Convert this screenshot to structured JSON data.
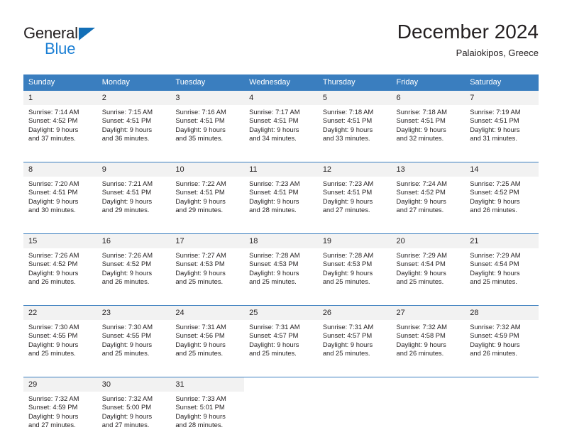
{
  "brand": {
    "name_primary": "General",
    "name_secondary": "Blue",
    "triangle_color": "#136fb7",
    "secondary_color": "#1b7fd4"
  },
  "header": {
    "title": "December 2024",
    "subtitle": "Palaiokipos, Greece",
    "header_bg": "#3a7ebf",
    "daynum_bg": "#f2f2f2"
  },
  "weekday_headers": [
    "Sunday",
    "Monday",
    "Tuesday",
    "Wednesday",
    "Thursday",
    "Friday",
    "Saturday"
  ],
  "weeks": [
    {
      "days": [
        {
          "num": "1",
          "sunrise": "Sunrise: 7:14 AM",
          "sunset": "Sunset: 4:52 PM",
          "daylight1": "Daylight: 9 hours",
          "daylight2": "and 37 minutes."
        },
        {
          "num": "2",
          "sunrise": "Sunrise: 7:15 AM",
          "sunset": "Sunset: 4:51 PM",
          "daylight1": "Daylight: 9 hours",
          "daylight2": "and 36 minutes."
        },
        {
          "num": "3",
          "sunrise": "Sunrise: 7:16 AM",
          "sunset": "Sunset: 4:51 PM",
          "daylight1": "Daylight: 9 hours",
          "daylight2": "and 35 minutes."
        },
        {
          "num": "4",
          "sunrise": "Sunrise: 7:17 AM",
          "sunset": "Sunset: 4:51 PM",
          "daylight1": "Daylight: 9 hours",
          "daylight2": "and 34 minutes."
        },
        {
          "num": "5",
          "sunrise": "Sunrise: 7:18 AM",
          "sunset": "Sunset: 4:51 PM",
          "daylight1": "Daylight: 9 hours",
          "daylight2": "and 33 minutes."
        },
        {
          "num": "6",
          "sunrise": "Sunrise: 7:18 AM",
          "sunset": "Sunset: 4:51 PM",
          "daylight1": "Daylight: 9 hours",
          "daylight2": "and 32 minutes."
        },
        {
          "num": "7",
          "sunrise": "Sunrise: 7:19 AM",
          "sunset": "Sunset: 4:51 PM",
          "daylight1": "Daylight: 9 hours",
          "daylight2": "and 31 minutes."
        }
      ]
    },
    {
      "days": [
        {
          "num": "8",
          "sunrise": "Sunrise: 7:20 AM",
          "sunset": "Sunset: 4:51 PM",
          "daylight1": "Daylight: 9 hours",
          "daylight2": "and 30 minutes."
        },
        {
          "num": "9",
          "sunrise": "Sunrise: 7:21 AM",
          "sunset": "Sunset: 4:51 PM",
          "daylight1": "Daylight: 9 hours",
          "daylight2": "and 29 minutes."
        },
        {
          "num": "10",
          "sunrise": "Sunrise: 7:22 AM",
          "sunset": "Sunset: 4:51 PM",
          "daylight1": "Daylight: 9 hours",
          "daylight2": "and 29 minutes."
        },
        {
          "num": "11",
          "sunrise": "Sunrise: 7:23 AM",
          "sunset": "Sunset: 4:51 PM",
          "daylight1": "Daylight: 9 hours",
          "daylight2": "and 28 minutes."
        },
        {
          "num": "12",
          "sunrise": "Sunrise: 7:23 AM",
          "sunset": "Sunset: 4:51 PM",
          "daylight1": "Daylight: 9 hours",
          "daylight2": "and 27 minutes."
        },
        {
          "num": "13",
          "sunrise": "Sunrise: 7:24 AM",
          "sunset": "Sunset: 4:52 PM",
          "daylight1": "Daylight: 9 hours",
          "daylight2": "and 27 minutes."
        },
        {
          "num": "14",
          "sunrise": "Sunrise: 7:25 AM",
          "sunset": "Sunset: 4:52 PM",
          "daylight1": "Daylight: 9 hours",
          "daylight2": "and 26 minutes."
        }
      ]
    },
    {
      "days": [
        {
          "num": "15",
          "sunrise": "Sunrise: 7:26 AM",
          "sunset": "Sunset: 4:52 PM",
          "daylight1": "Daylight: 9 hours",
          "daylight2": "and 26 minutes."
        },
        {
          "num": "16",
          "sunrise": "Sunrise: 7:26 AM",
          "sunset": "Sunset: 4:52 PM",
          "daylight1": "Daylight: 9 hours",
          "daylight2": "and 26 minutes."
        },
        {
          "num": "17",
          "sunrise": "Sunrise: 7:27 AM",
          "sunset": "Sunset: 4:53 PM",
          "daylight1": "Daylight: 9 hours",
          "daylight2": "and 25 minutes."
        },
        {
          "num": "18",
          "sunrise": "Sunrise: 7:28 AM",
          "sunset": "Sunset: 4:53 PM",
          "daylight1": "Daylight: 9 hours",
          "daylight2": "and 25 minutes."
        },
        {
          "num": "19",
          "sunrise": "Sunrise: 7:28 AM",
          "sunset": "Sunset: 4:53 PM",
          "daylight1": "Daylight: 9 hours",
          "daylight2": "and 25 minutes."
        },
        {
          "num": "20",
          "sunrise": "Sunrise: 7:29 AM",
          "sunset": "Sunset: 4:54 PM",
          "daylight1": "Daylight: 9 hours",
          "daylight2": "and 25 minutes."
        },
        {
          "num": "21",
          "sunrise": "Sunrise: 7:29 AM",
          "sunset": "Sunset: 4:54 PM",
          "daylight1": "Daylight: 9 hours",
          "daylight2": "and 25 minutes."
        }
      ]
    },
    {
      "days": [
        {
          "num": "22",
          "sunrise": "Sunrise: 7:30 AM",
          "sunset": "Sunset: 4:55 PM",
          "daylight1": "Daylight: 9 hours",
          "daylight2": "and 25 minutes."
        },
        {
          "num": "23",
          "sunrise": "Sunrise: 7:30 AM",
          "sunset": "Sunset: 4:55 PM",
          "daylight1": "Daylight: 9 hours",
          "daylight2": "and 25 minutes."
        },
        {
          "num": "24",
          "sunrise": "Sunrise: 7:31 AM",
          "sunset": "Sunset: 4:56 PM",
          "daylight1": "Daylight: 9 hours",
          "daylight2": "and 25 minutes."
        },
        {
          "num": "25",
          "sunrise": "Sunrise: 7:31 AM",
          "sunset": "Sunset: 4:57 PM",
          "daylight1": "Daylight: 9 hours",
          "daylight2": "and 25 minutes."
        },
        {
          "num": "26",
          "sunrise": "Sunrise: 7:31 AM",
          "sunset": "Sunset: 4:57 PM",
          "daylight1": "Daylight: 9 hours",
          "daylight2": "and 25 minutes."
        },
        {
          "num": "27",
          "sunrise": "Sunrise: 7:32 AM",
          "sunset": "Sunset: 4:58 PM",
          "daylight1": "Daylight: 9 hours",
          "daylight2": "and 26 minutes."
        },
        {
          "num": "28",
          "sunrise": "Sunrise: 7:32 AM",
          "sunset": "Sunset: 4:59 PM",
          "daylight1": "Daylight: 9 hours",
          "daylight2": "and 26 minutes."
        }
      ]
    },
    {
      "days": [
        {
          "num": "29",
          "sunrise": "Sunrise: 7:32 AM",
          "sunset": "Sunset: 4:59 PM",
          "daylight1": "Daylight: 9 hours",
          "daylight2": "and 27 minutes."
        },
        {
          "num": "30",
          "sunrise": "Sunrise: 7:32 AM",
          "sunset": "Sunset: 5:00 PM",
          "daylight1": "Daylight: 9 hours",
          "daylight2": "and 27 minutes."
        },
        {
          "num": "31",
          "sunrise": "Sunrise: 7:33 AM",
          "sunset": "Sunset: 5:01 PM",
          "daylight1": "Daylight: 9 hours",
          "daylight2": "and 28 minutes."
        },
        {
          "num": "",
          "sunrise": "",
          "sunset": "",
          "daylight1": "",
          "daylight2": ""
        },
        {
          "num": "",
          "sunrise": "",
          "sunset": "",
          "daylight1": "",
          "daylight2": ""
        },
        {
          "num": "",
          "sunrise": "",
          "sunset": "",
          "daylight1": "",
          "daylight2": ""
        },
        {
          "num": "",
          "sunrise": "",
          "sunset": "",
          "daylight1": "",
          "daylight2": ""
        }
      ]
    }
  ]
}
